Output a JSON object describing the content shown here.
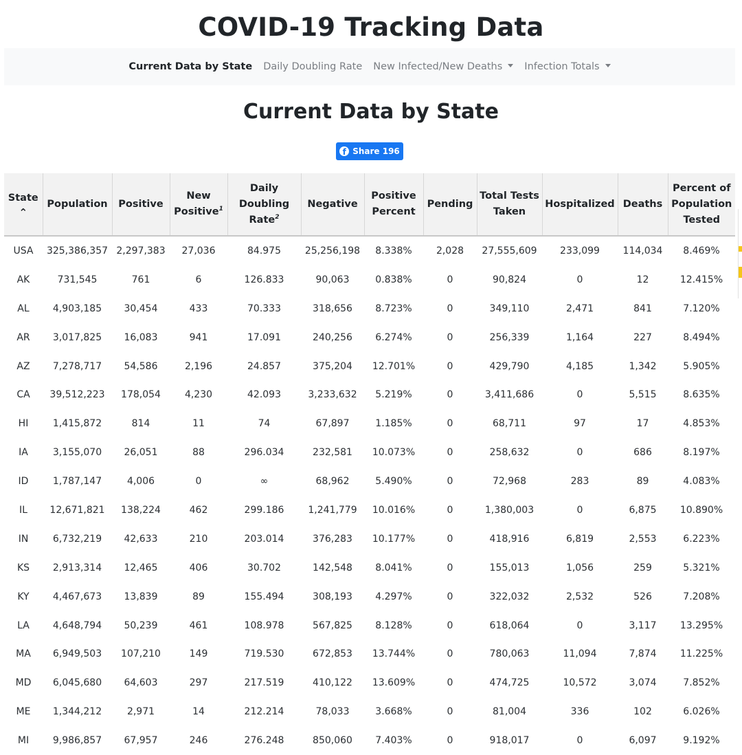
{
  "site_title": "COVID-19 Tracking Data",
  "nav": {
    "items": [
      {
        "label": "Current Data by State",
        "active": true,
        "dropdown": false
      },
      {
        "label": "Daily Doubling Rate",
        "active": false,
        "dropdown": false
      },
      {
        "label": "New Infected/New Deaths",
        "active": false,
        "dropdown": true
      },
      {
        "label": "Infection Totals",
        "active": false,
        "dropdown": true
      }
    ]
  },
  "page_heading": "Current Data by State",
  "share": {
    "label": "Share 196",
    "icon": "facebook-icon",
    "color": "#1877f2"
  },
  "table": {
    "columns": [
      {
        "label": "State",
        "sup": "",
        "sort_icon": "chevron-up-icon"
      },
      {
        "label": "Population",
        "sup": ""
      },
      {
        "label": "Positive",
        "sup": ""
      },
      {
        "label": "New Positive",
        "sup": "1"
      },
      {
        "label": "Daily Doubling Rate",
        "sup": "2"
      },
      {
        "label": "Negative",
        "sup": ""
      },
      {
        "label": "Positive Percent",
        "sup": ""
      },
      {
        "label": "Pending",
        "sup": ""
      },
      {
        "label": "Total Tests Taken",
        "sup": ""
      },
      {
        "label": "Hospitalized",
        "sup": ""
      },
      {
        "label": "Deaths",
        "sup": ""
      },
      {
        "label": "Percent of Population Tested",
        "sup": ""
      }
    ],
    "rows": [
      [
        "USA",
        "325,386,357",
        "2,297,383",
        "27,036",
        "84.975",
        "25,256,198",
        "8.338%",
        "2,028",
        "27,555,609",
        "233,099",
        "114,034",
        "8.469%"
      ],
      [
        "AK",
        "731,545",
        "761",
        "6",
        "126.833",
        "90,063",
        "0.838%",
        "0",
        "90,824",
        "0",
        "12",
        "12.415%"
      ],
      [
        "AL",
        "4,903,185",
        "30,454",
        "433",
        "70.333",
        "318,656",
        "8.723%",
        "0",
        "349,110",
        "2,471",
        "841",
        "7.120%"
      ],
      [
        "AR",
        "3,017,825",
        "16,083",
        "941",
        "17.091",
        "240,256",
        "6.274%",
        "0",
        "256,339",
        "1,164",
        "227",
        "8.494%"
      ],
      [
        "AZ",
        "7,278,717",
        "54,586",
        "2,196",
        "24.857",
        "375,204",
        "12.701%",
        "0",
        "429,790",
        "4,185",
        "1,342",
        "5.905%"
      ],
      [
        "CA",
        "39,512,223",
        "178,054",
        "4,230",
        "42.093",
        "3,233,632",
        "5.219%",
        "0",
        "3,411,686",
        "0",
        "5,515",
        "8.635%"
      ],
      [
        "HI",
        "1,415,872",
        "814",
        "11",
        "74",
        "67,897",
        "1.185%",
        "0",
        "68,711",
        "97",
        "17",
        "4.853%"
      ],
      [
        "IA",
        "3,155,070",
        "26,051",
        "88",
        "296.034",
        "232,581",
        "10.073%",
        "0",
        "258,632",
        "0",
        "686",
        "8.197%"
      ],
      [
        "ID",
        "1,787,147",
        "4,006",
        "0",
        "∞",
        "68,962",
        "5.490%",
        "0",
        "72,968",
        "283",
        "89",
        "4.083%"
      ],
      [
        "IL",
        "12,671,821",
        "138,224",
        "462",
        "299.186",
        "1,241,779",
        "10.016%",
        "0",
        "1,380,003",
        "0",
        "6,875",
        "10.890%"
      ],
      [
        "IN",
        "6,732,219",
        "42,633",
        "210",
        "203.014",
        "376,283",
        "10.177%",
        "0",
        "418,916",
        "6,819",
        "2,553",
        "6.223%"
      ],
      [
        "KS",
        "2,913,314",
        "12,465",
        "406",
        "30.702",
        "142,548",
        "8.041%",
        "0",
        "155,013",
        "1,056",
        "259",
        "5.321%"
      ],
      [
        "KY",
        "4,467,673",
        "13,839",
        "89",
        "155.494",
        "308,193",
        "4.297%",
        "0",
        "322,032",
        "2,532",
        "526",
        "7.208%"
      ],
      [
        "LA",
        "4,648,794",
        "50,239",
        "461",
        "108.978",
        "567,825",
        "8.128%",
        "0",
        "618,064",
        "0",
        "3,117",
        "13.295%"
      ],
      [
        "MA",
        "6,949,503",
        "107,210",
        "149",
        "719.530",
        "672,853",
        "13.744%",
        "0",
        "780,063",
        "11,094",
        "7,874",
        "11.225%"
      ],
      [
        "MD",
        "6,045,680",
        "64,603",
        "297",
        "217.519",
        "410,122",
        "13.609%",
        "0",
        "474,725",
        "10,572",
        "3,074",
        "7.852%"
      ],
      [
        "ME",
        "1,344,212",
        "2,971",
        "14",
        "212.214",
        "78,033",
        "3.668%",
        "0",
        "81,004",
        "336",
        "102",
        "6.026%"
      ],
      [
        "MI",
        "9,986,857",
        "67,957",
        "246",
        "276.248",
        "850,060",
        "7.403%",
        "0",
        "918,017",
        "0",
        "6,097",
        "9.192%"
      ]
    ]
  }
}
